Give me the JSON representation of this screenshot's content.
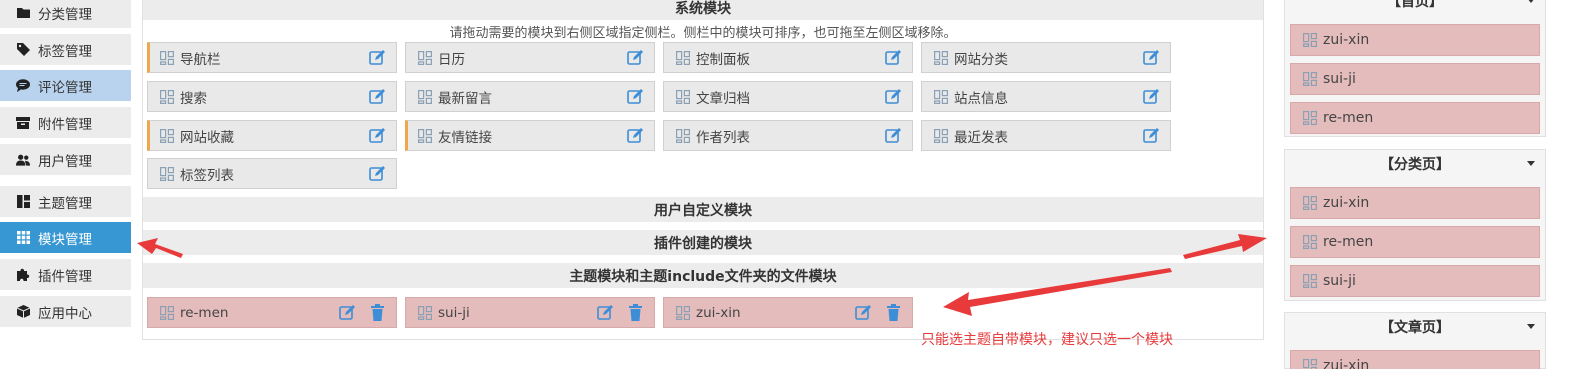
{
  "sidebar": {
    "items": [
      {
        "label": "分类管理",
        "icon": "folder-icon"
      },
      {
        "label": "标签管理",
        "icon": "tag-icon"
      },
      {
        "label": "评论管理",
        "icon": "comment-icon"
      },
      {
        "label": "附件管理",
        "icon": "archive-icon"
      },
      {
        "label": "用户管理",
        "icon": "users-icon"
      },
      {
        "label": "主题管理",
        "icon": "layout-icon"
      },
      {
        "label": "模块管理",
        "icon": "grid-icon"
      },
      {
        "label": "插件管理",
        "icon": "puzzle-icon"
      },
      {
        "label": "应用中心",
        "icon": "box-icon"
      }
    ]
  },
  "main": {
    "system_section": {
      "title": "系统模块",
      "hint": "请拖动需要的模块到右侧区域指定侧栏。侧栏中的模块可排序，也可拖至左侧区域移除。",
      "modules": [
        "导航栏",
        "日历",
        "控制面板",
        "网站分类",
        "搜索",
        "最新留言",
        "文章归档",
        "站点信息",
        "网站收藏",
        "友情链接",
        "作者列表",
        "最近发表",
        "标签列表"
      ]
    },
    "user_section": {
      "title": "用户自定义模块"
    },
    "plugin_section": {
      "title": "插件创建的模块"
    },
    "theme_section": {
      "title": "主题模块和主题include文件夹的文件模块",
      "modules": [
        "re-men",
        "sui-ji",
        "zui-xin"
      ]
    }
  },
  "right": {
    "panels": [
      {
        "title": "【首页】",
        "items": [
          "zui-xin",
          "sui-ji",
          "re-men"
        ]
      },
      {
        "title": "【分类页】",
        "items": [
          "zui-xin",
          "re-men",
          "sui-ji"
        ]
      },
      {
        "title": "【文章页】",
        "items": [
          "zui-xin"
        ]
      }
    ]
  },
  "annotation": {
    "note": "只能选主题自带模块，建议只选一个模块",
    "color": "#e83a3a"
  },
  "colors": {
    "active": "#3797d3",
    "highlight": "#b9d3ef",
    "pink": "#e5bcbc",
    "orange_border": "#f0a64b",
    "action_icon": "#3d8ed6"
  }
}
